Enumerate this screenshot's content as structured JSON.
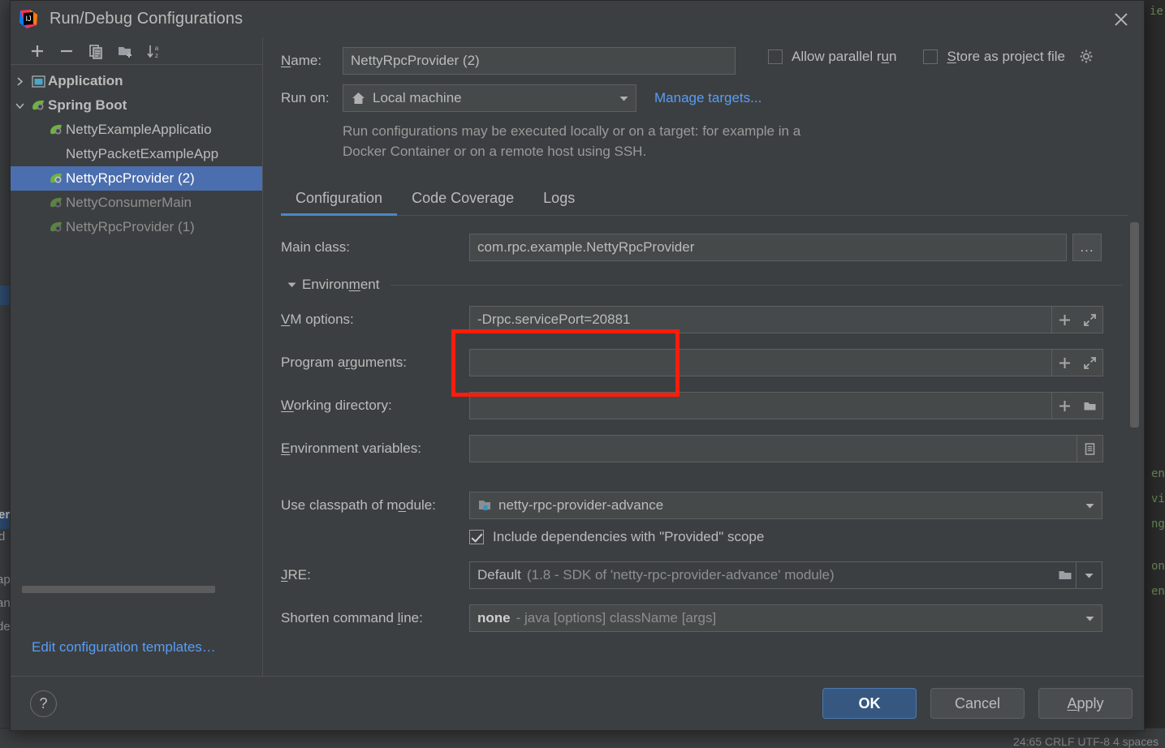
{
  "dialog": {
    "title": "Run/Debug Configurations",
    "logo_icon": "intellij-idea-logo",
    "close_icon": "close-icon"
  },
  "sidebar": {
    "toolbar": [
      {
        "name": "add-configuration-button",
        "icon": "plus-icon"
      },
      {
        "name": "remove-configuration-button",
        "icon": "minus-icon"
      },
      {
        "name": "copy-configuration-button",
        "icon": "copy-icon"
      },
      {
        "name": "new-folder-button",
        "icon": "folder-plus-icon"
      },
      {
        "name": "sort-configurations-button",
        "icon": "sort-az-icon"
      }
    ],
    "tree": [
      {
        "label": "Application",
        "icon": "application-icon",
        "level": 0,
        "expanded": false,
        "bold": true,
        "selected": false,
        "dim": false
      },
      {
        "label": "Spring Boot",
        "icon": "spring-boot-icon",
        "level": 0,
        "expanded": true,
        "bold": true,
        "selected": false,
        "dim": false
      },
      {
        "label": "NettyExampleApplicatio",
        "icon": "spring-boot-icon",
        "level": 1,
        "bold": false,
        "selected": false,
        "dim": false
      },
      {
        "label": "NettyPacketExampleApp",
        "icon": "none",
        "level": 1,
        "bold": false,
        "selected": false,
        "dim": false
      },
      {
        "label": "NettyRpcProvider (2)",
        "icon": "spring-boot-icon",
        "level": 1,
        "bold": false,
        "selected": true,
        "dim": false
      },
      {
        "label": "NettyConsumerMain",
        "icon": "spring-boot-icon",
        "level": 1,
        "bold": false,
        "selected": false,
        "dim": true
      },
      {
        "label": "NettyRpcProvider (1)",
        "icon": "spring-boot-icon",
        "level": 1,
        "bold": false,
        "selected": false,
        "dim": true
      }
    ],
    "edit_templates_link": "Edit configuration templates…"
  },
  "form": {
    "name_label": "Name:",
    "name_value": "NettyRpcProvider (2)",
    "allow_parallel_run_label": "Allow parallel run",
    "allow_parallel_run_checked": false,
    "store_as_project_file_label": "Store as project file",
    "store_as_project_file_checked": false,
    "store_gear_icon": "gear-icon",
    "run_on_label": "Run on:",
    "run_on_value": "Local machine",
    "run_on_icon": "home-icon",
    "manage_targets_link": "Manage targets...",
    "description": "Run configurations may be executed locally or on a target: for example in a Docker Container or on a remote host using SSH."
  },
  "tabs": [
    {
      "label": "Configuration",
      "active": true
    },
    {
      "label": "Code Coverage",
      "active": false
    },
    {
      "label": "Logs",
      "active": false
    }
  ],
  "fields": {
    "main_class_label": "Main class:",
    "main_class_value": "com.rpc.example.NettyRpcProvider",
    "main_class_browse": "...",
    "environment_section": "Environment",
    "vm_options_label": "VM options:",
    "vm_options_value": "-Drpc.servicePort=20881",
    "program_arguments_label": "Program arguments:",
    "program_arguments_value": "",
    "working_directory_label": "Working directory:",
    "working_directory_value": "",
    "environment_variables_label": "Environment variables:",
    "environment_variables_value": "",
    "use_classpath_label": "Use classpath of module:",
    "use_classpath_value": "netty-rpc-provider-advance",
    "include_dependencies_label": "Include dependencies with \"Provided\" scope",
    "include_dependencies_checked": true,
    "jre_label": "JRE:",
    "jre_value_main": "Default",
    "jre_value_detail": "(1.8 - SDK of 'netty-rpc-provider-advance' module)",
    "shorten_cmd_label": "Shorten command line:",
    "shorten_cmd_value_main": "none",
    "shorten_cmd_value_detail": "- java [options] className [args]"
  },
  "buttons": {
    "help": "?",
    "ok": "OK",
    "cancel": "Cancel",
    "apply": "Apply"
  },
  "annotation": {
    "highlight_color": "#fc1d0b",
    "target": "vm-options-field"
  },
  "background_ide": {
    "status_bar": "24:65    CRLF    UTF-8    4 spaces",
    "left_fragments": [
      "er",
      "d",
      "ap",
      "an",
      "de"
    ],
    "right_fragments": [
      "ie",
      "en",
      "vi",
      "ng",
      "on",
      "en"
    ]
  }
}
